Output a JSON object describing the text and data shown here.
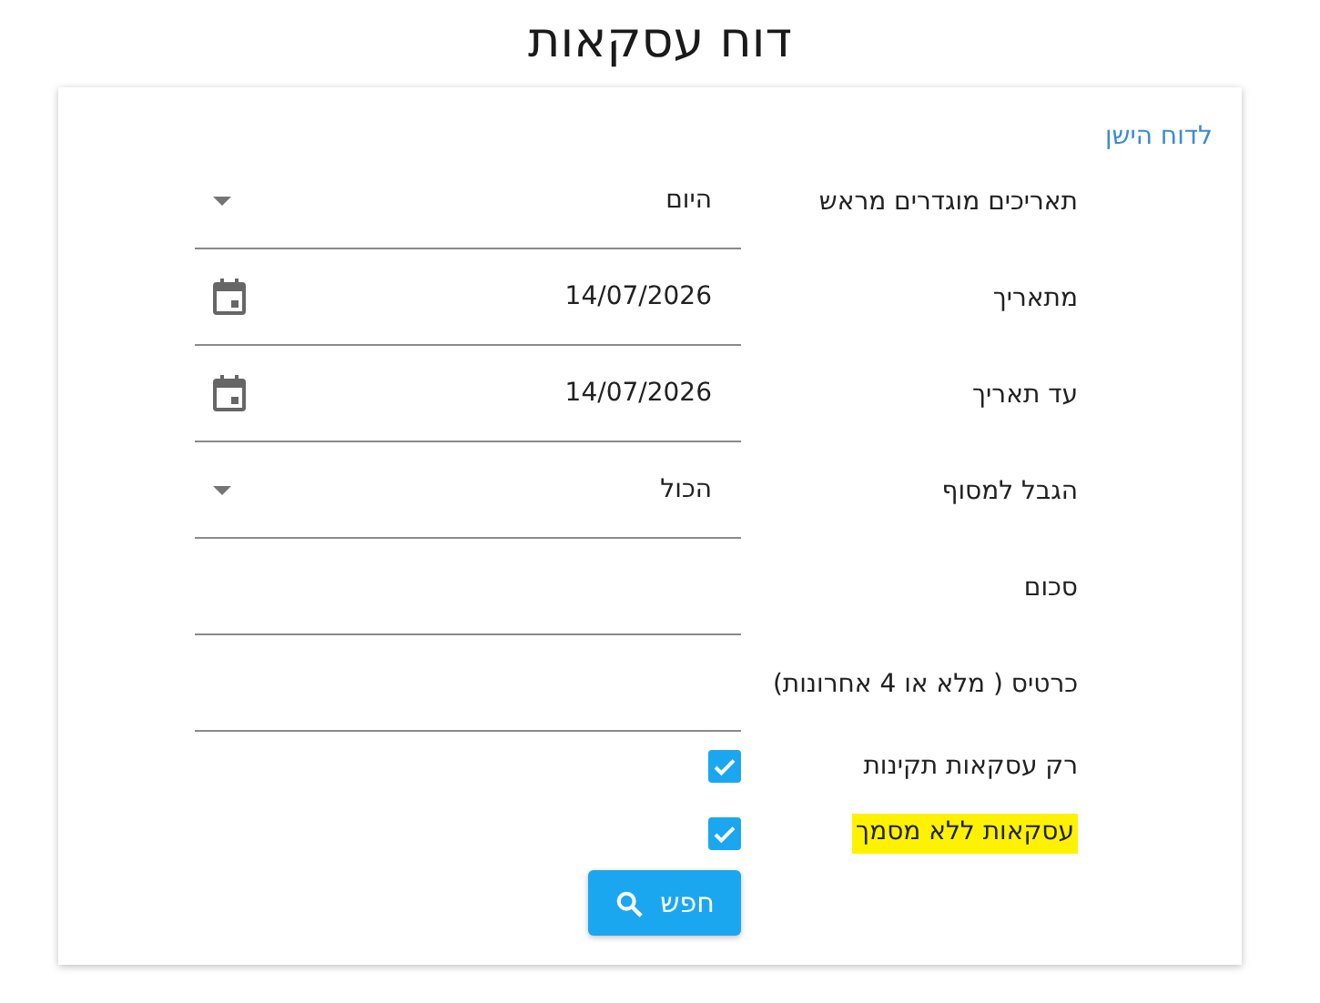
{
  "title": "דוח עסקאות",
  "old_report_link": "לדוח הישן",
  "fields": [
    {
      "kind": "select",
      "label": "תאריכים מוגדרים מראש",
      "value": "היום"
    },
    {
      "kind": "date",
      "label": "מתאריך",
      "value": "14/07/2026"
    },
    {
      "kind": "date",
      "label": "עד תאריך",
      "value": "14/07/2026"
    },
    {
      "kind": "select",
      "label": "הגבל למסוף",
      "value": "הכול"
    },
    {
      "kind": "text",
      "label": "סכום"
    },
    {
      "kind": "text",
      "label": "כרטיס ( מלא או 4 אחרונות)"
    },
    {
      "kind": "checkbox",
      "label": "רק עסקאות תקינות",
      "checked": true,
      "highlighted": false
    },
    {
      "kind": "checkbox",
      "label": "עסקאות ללא מסמך",
      "checked": true,
      "highlighted": true
    }
  ],
  "search_button": "חפש"
}
